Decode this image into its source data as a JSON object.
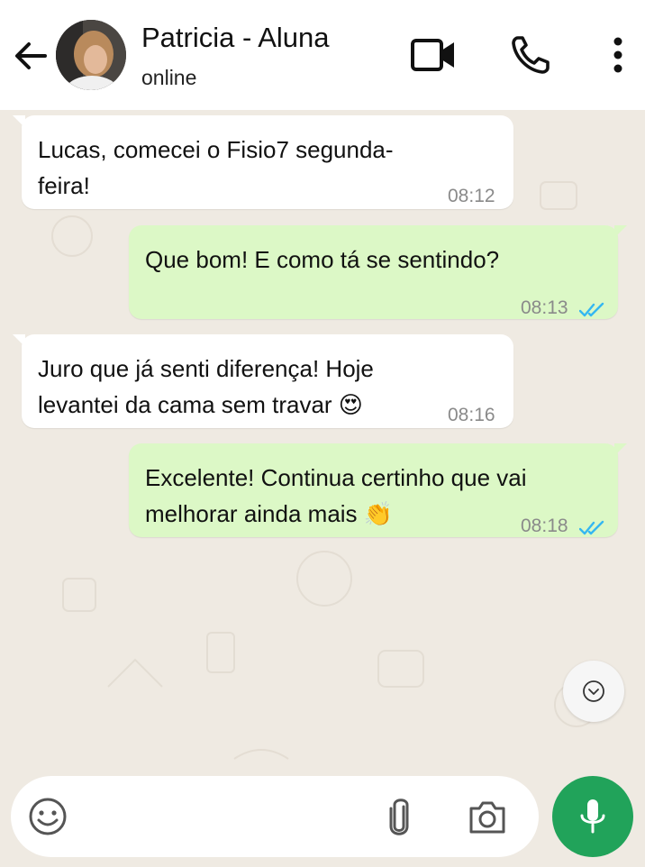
{
  "header": {
    "contact_name": "Patricia - Aluna",
    "status": "online"
  },
  "messages": [
    {
      "direction": "in",
      "text": "Lucas, comecei o Fisio7 segunda-\nfeira!",
      "time": "08:12"
    },
    {
      "direction": "out",
      "text": "Que bom! E como tá se sentindo?",
      "time": "08:13",
      "read": true
    },
    {
      "direction": "in",
      "text": "Juro que já senti diferença! Hoje\nlevantei da cama sem travar 😍",
      "time": "08:16"
    },
    {
      "direction": "out",
      "text": "Excelente! Continua certinho que vai\nmelhorar ainda mais 👏",
      "time": "08:18",
      "read": true
    }
  ],
  "composer": {
    "placeholder": ""
  },
  "colors": {
    "incoming_bubble": "#ffffff",
    "outgoing_bubble": "#dcf8c6",
    "read_ticks": "#34b7f1",
    "mic_button": "#21a35a",
    "chat_background": "#efeae2"
  },
  "icons": [
    "back-arrow-icon",
    "video-call-icon",
    "phone-icon",
    "more-options-icon",
    "double-check-icon",
    "chevron-down-icon",
    "emoji-icon",
    "attach-icon",
    "camera-icon",
    "mic-icon"
  ]
}
